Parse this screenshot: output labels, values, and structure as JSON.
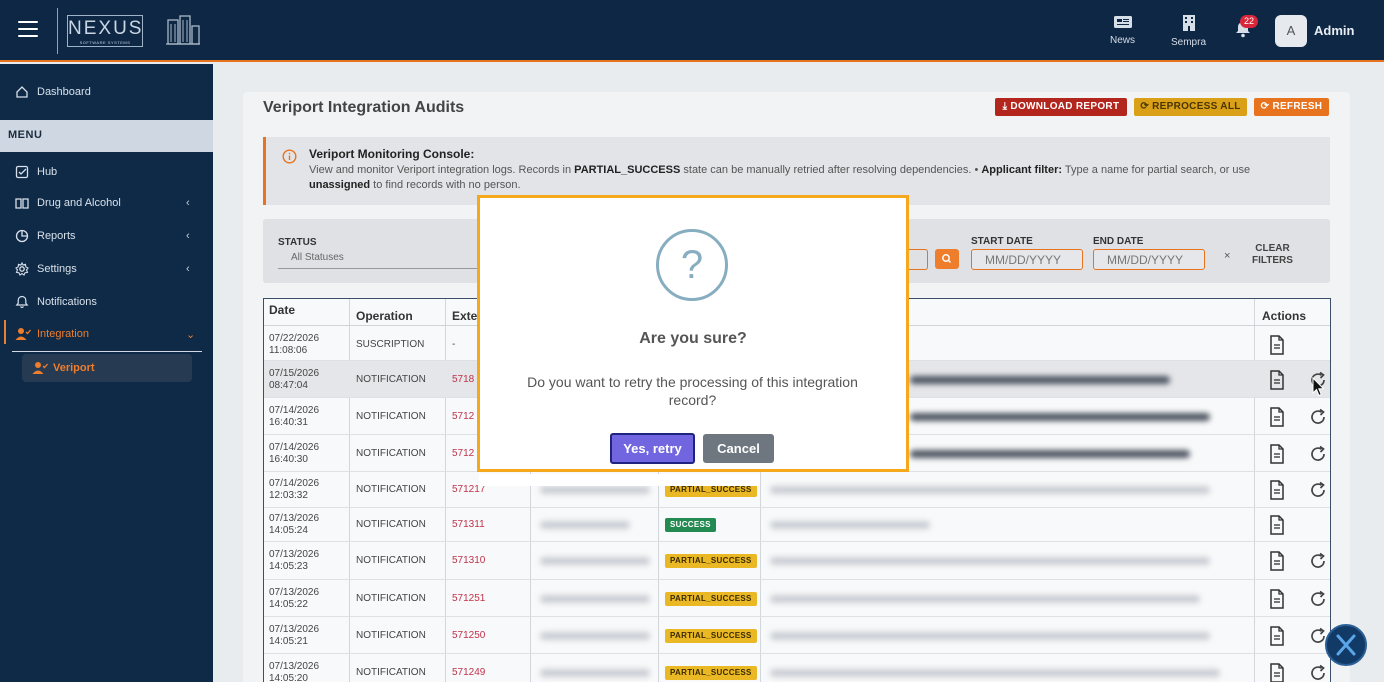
{
  "topbar": {
    "logo_word": "NEXUS",
    "logo_sub": "SOFTWARE SYSTEMS",
    "news_label": "News",
    "sempra_label": "Sempra",
    "notification_count": "22",
    "avatar_initial": "A",
    "user_name": "Admin"
  },
  "sidebar": {
    "dashboard": "Dashboard",
    "menu_heading": "MENU",
    "hub": "Hub",
    "drug_alcohol": "Drug and Alcohol",
    "reports": "Reports",
    "settings": "Settings",
    "notifications": "Notifications",
    "integration": "Integration",
    "veriport": "Veriport",
    "accent_color": "#ee7d2c"
  },
  "page": {
    "title": "Veriport Integration Audits",
    "download_btn": "DOWNLOAD REPORT",
    "reprocess_btn": "REPROCESS ALL",
    "refresh_btn": "REFRESH"
  },
  "info": {
    "title": "Veriport Monitoring Console:",
    "line1_a": "View and monitor Veriport integration logs. Records in ",
    "line1_b": "PARTIAL_SUCCESS",
    "line1_c": " state can be manually retried after resolving dependencies.  •  ",
    "line1_d": "Applicant filter:",
    "line1_e": " Type a name for partial search, or use",
    "line2_a": "unassigned",
    "line2_b": " to find records with no person."
  },
  "filters": {
    "status_label": "STATUS",
    "status_value": "All Statuses",
    "start_label": "START DATE",
    "end_label": "END DATE",
    "start_placeholder": "MM/DD/YYYY",
    "end_placeholder": "MM/DD/YYYY",
    "clear_x": "×",
    "clear_line1": "CLEAR",
    "clear_line2": "FILTERS"
  },
  "table": {
    "headers": {
      "date": "Date",
      "operation": "Operation",
      "external": "Exter",
      "actions": "Actions"
    },
    "rows": [
      {
        "date1": "07/22/2026",
        "date2": "11:08:06",
        "operation": "SUSCRIPTION",
        "ext": "-",
        "status": ""
      },
      {
        "date1": "07/15/2026",
        "date2": "08:47:04",
        "operation": "NOTIFICATION",
        "ext": "5718",
        "status": ""
      },
      {
        "date1": "07/14/2026",
        "date2": "16:40:31",
        "operation": "NOTIFICATION",
        "ext": "5712",
        "status": ""
      },
      {
        "date1": "07/14/2026",
        "date2": "16:40:30",
        "operation": "NOTIFICATION",
        "ext": "5712",
        "status": ""
      },
      {
        "date1": "07/14/2026",
        "date2": "12:03:32",
        "operation": "NOTIFICATION",
        "ext": "571217",
        "status": "PARTIAL_SUCCESS"
      },
      {
        "date1": "07/13/2026",
        "date2": "14:05:24",
        "operation": "NOTIFICATION",
        "ext": "571311",
        "status": "SUCCESS"
      },
      {
        "date1": "07/13/2026",
        "date2": "14:05:23",
        "operation": "NOTIFICATION",
        "ext": "571310",
        "status": "PARTIAL_SUCCESS"
      },
      {
        "date1": "07/13/2026",
        "date2": "14:05:22",
        "operation": "NOTIFICATION",
        "ext": "571251",
        "status": "PARTIAL_SUCCESS"
      },
      {
        "date1": "07/13/2026",
        "date2": "14:05:21",
        "operation": "NOTIFICATION",
        "ext": "571250",
        "status": "PARTIAL_SUCCESS"
      },
      {
        "date1": "07/13/2026",
        "date2": "14:05:20",
        "operation": "NOTIFICATION",
        "ext": "571249",
        "status": "PARTIAL_SUCCESS"
      }
    ]
  },
  "modal": {
    "icon": "?",
    "title": "Are you sure?",
    "text": "Do you want to retry the processing of this integration record?",
    "confirm": "Yes, retry",
    "cancel": "Cancel"
  }
}
